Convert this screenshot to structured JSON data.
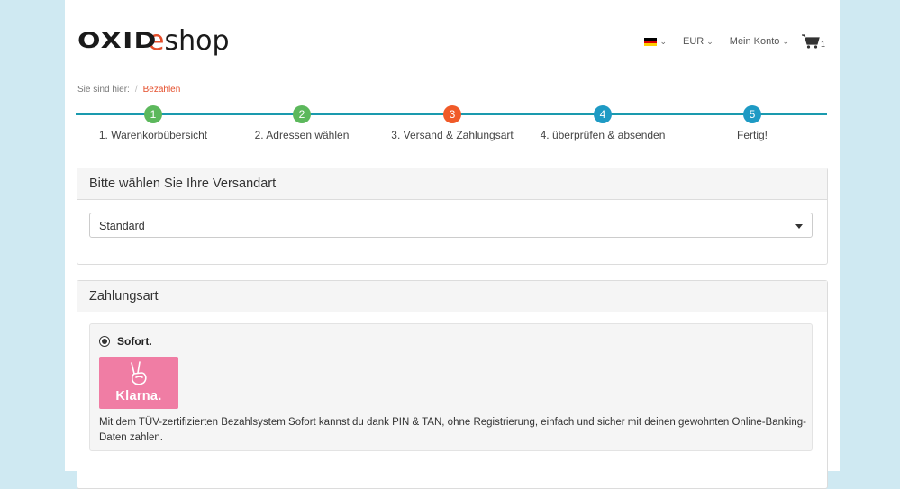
{
  "header": {
    "logo_oxid": "OXID",
    "logo_e": "e",
    "logo_shop": "shop",
    "currency": "EUR",
    "account": "Mein Konto",
    "cart_count": "1"
  },
  "breadcrumb": {
    "prefix": "Sie sind hier:",
    "separator": "/",
    "current": "Bezahlen"
  },
  "steps": [
    {
      "number": "1",
      "label": "1. Warenkorbübersicht",
      "color": "#5cb85c"
    },
    {
      "number": "2",
      "label": "2. Adressen wählen",
      "color": "#5cb85c"
    },
    {
      "number": "3",
      "label": "3. Versand & Zahlungsart",
      "color": "#f05a28"
    },
    {
      "number": "4",
      "label": "4. überprüfen & absenden",
      "color": "#1e9ac4"
    },
    {
      "number": "5",
      "label": "Fertig!",
      "color": "#1e9ac4"
    }
  ],
  "shipping": {
    "title": "Bitte wählen Sie Ihre Versandart",
    "selected": "Standard"
  },
  "payment": {
    "title": "Zahlungsart",
    "option_label": "Sofort.",
    "logo_text": "Klarna.",
    "description": "Mit dem TÜV-zertifizierten Bezahlsystem Sofort kannst du dank PIN & TAN, ohne Registrierung, einfach und sicher mit deinen gewohnten Online-Banking-Daten zahlen."
  },
  "icons": {
    "flag": "german-flag-icon",
    "cart": "cart-icon",
    "klarna": "peace-hand-icon"
  },
  "colors": {
    "accent": "#e54e2b",
    "step_line": "#1a9aae",
    "background": "#cfe9f2"
  }
}
